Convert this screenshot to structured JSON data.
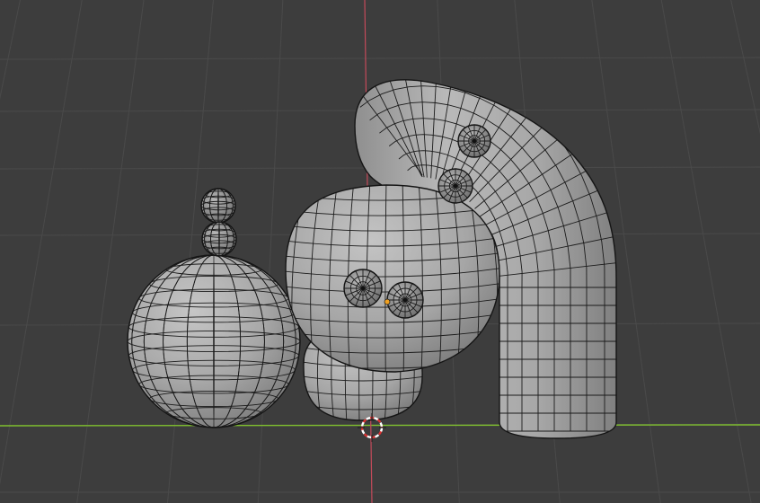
{
  "viewport": {
    "view": "3d-viewport",
    "background_color": "#3d3d3d",
    "grid_color": "#4a4a4a",
    "x_axis_color": "#7fbf2e",
    "z_axis_color": "#c44a5a",
    "mesh_color": "#a9a9a9",
    "wire_color": "#1b1b1b"
  },
  "scene": {
    "objects": [
      {
        "name": "large-sphere"
      },
      {
        "name": "stacked-small-spheres"
      },
      {
        "name": "head-mesh"
      },
      {
        "name": "body-mesh"
      },
      {
        "name": "bent-tube-mesh"
      },
      {
        "name": "eyes"
      }
    ],
    "cursor_icon": "3d-cursor-icon",
    "origin_icon": "object-origin-icon"
  }
}
